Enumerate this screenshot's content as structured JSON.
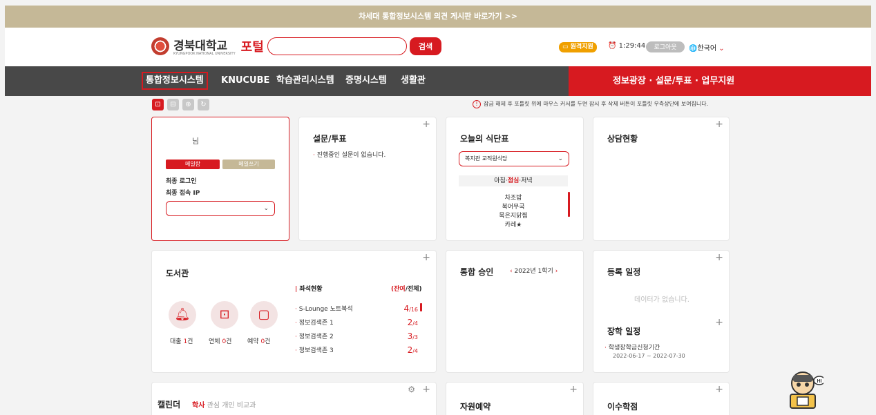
{
  "topbar": {
    "text": "차세대 통합정보시스템 의견 게시판 바로가기 >>"
  },
  "header": {
    "logo_name": "경북대학교",
    "logo_sub": "KYUNGPOOK NATIONAL UNIVERSITY",
    "portal": "포털",
    "search_value": "",
    "search_label": "검색",
    "remote_label": "원격지원",
    "timer": "1:29:44",
    "logout_label": "로그아웃",
    "lang_label": "한국어"
  },
  "nav": {
    "items": [
      "통합정보시스템",
      "KNUCUBE",
      "학습관리시스템",
      "증명시스템",
      "생활관"
    ],
    "right": "정보광장 · 설문/투표 · 업무지원"
  },
  "notice": "잠금 해제 후 포틀릿 위에 마우스 커서를 두면 잠시 후 삭제 버튼이 포틀릿 우측상단에 보여집니다.",
  "profile": {
    "name_suffix": "님",
    "mail_btn": "메일함",
    "write_btn": "메일쓰기",
    "last_login": "최종 로그인",
    "last_ip": "최종 접속 IP",
    "select_value": ""
  },
  "survey": {
    "title": "설문/투표",
    "empty": "진행중인 설문이 없습니다."
  },
  "meal": {
    "title": "오늘의 식단표",
    "cafeteria": "복지관 교직원식당",
    "tabs": [
      "아침",
      "점심",
      "저녁"
    ],
    "menu": [
      "차조밥",
      "북어무국",
      "묵은지닭찜",
      "카레★"
    ]
  },
  "counsel": {
    "title": "상담현황"
  },
  "library": {
    "title": "도서관",
    "stats": [
      {
        "label": "대출",
        "value": "1",
        "unit": "건"
      },
      {
        "label": "연체",
        "value": "0",
        "unit": "건"
      },
      {
        "label": "예약",
        "value": "0",
        "unit": "건"
      }
    ],
    "seat_title": "좌석현황",
    "seat_header_red": "(잔여",
    "seat_header_rest": "/전체)",
    "seats": [
      {
        "name": "S-Lounge 노트북석",
        "remain": "4",
        "total": "/16"
      },
      {
        "name": "정보검색존 1",
        "remain": "2",
        "total": "/4"
      },
      {
        "name": "정보검색존 2",
        "remain": "3",
        "total": "/3"
      },
      {
        "name": "정보검색존 3",
        "remain": "2",
        "total": "/4"
      }
    ]
  },
  "approval": {
    "title": "통합 승인",
    "semester": "2022년 1학기"
  },
  "schedule": {
    "title": "등록 일정",
    "empty": "데이터가 없습니다.",
    "scholar_title": "장학 일정",
    "scholar_item": "학생장학금신청기간",
    "scholar_dates": "2022-06-17 ~ 2022-07-30"
  },
  "calendar": {
    "title": "캘린더",
    "tabs": [
      "학사",
      "관심",
      "개인",
      "비교과"
    ]
  },
  "resource": {
    "title": "자원예약"
  },
  "credits": {
    "title": "이수학점"
  },
  "robot": {
    "hi": "HI"
  }
}
